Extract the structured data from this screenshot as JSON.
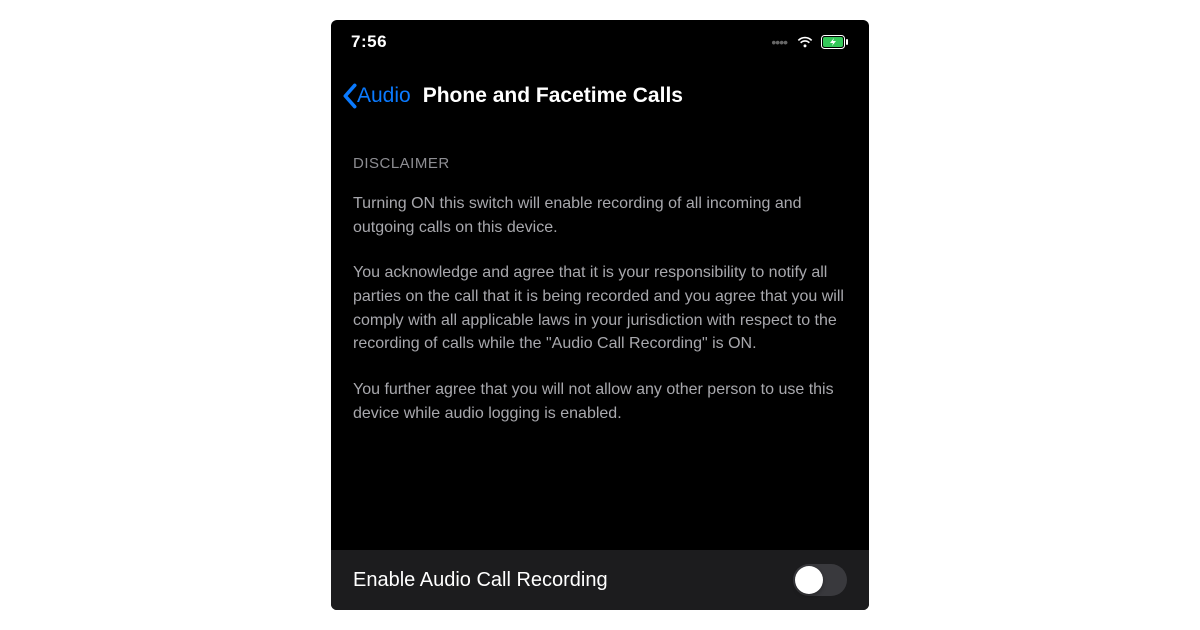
{
  "statusBar": {
    "time": "7:56"
  },
  "nav": {
    "backLabel": "Audio",
    "title": "Phone and Facetime Calls"
  },
  "section": {
    "header": "DISCLAIMER",
    "para1": "Turning ON this switch will enable recording of all incoming and outgoing calls on this device.",
    "para2": "You acknowledge and agree that it is your responsibility to notify all parties on the call that it is being recorded and you agree that you will comply with all applicable laws in your jurisdiction with respect to the recording of calls while the \"Audio Call Recording\" is ON.",
    "para3": "You further agree that you will not allow any other person to use this device while audio logging is enabled."
  },
  "toggle": {
    "label": "Enable Audio Call Recording",
    "enabled": false
  },
  "colors": {
    "accent": "#0a7aff",
    "batteryFill": "#34c759"
  }
}
